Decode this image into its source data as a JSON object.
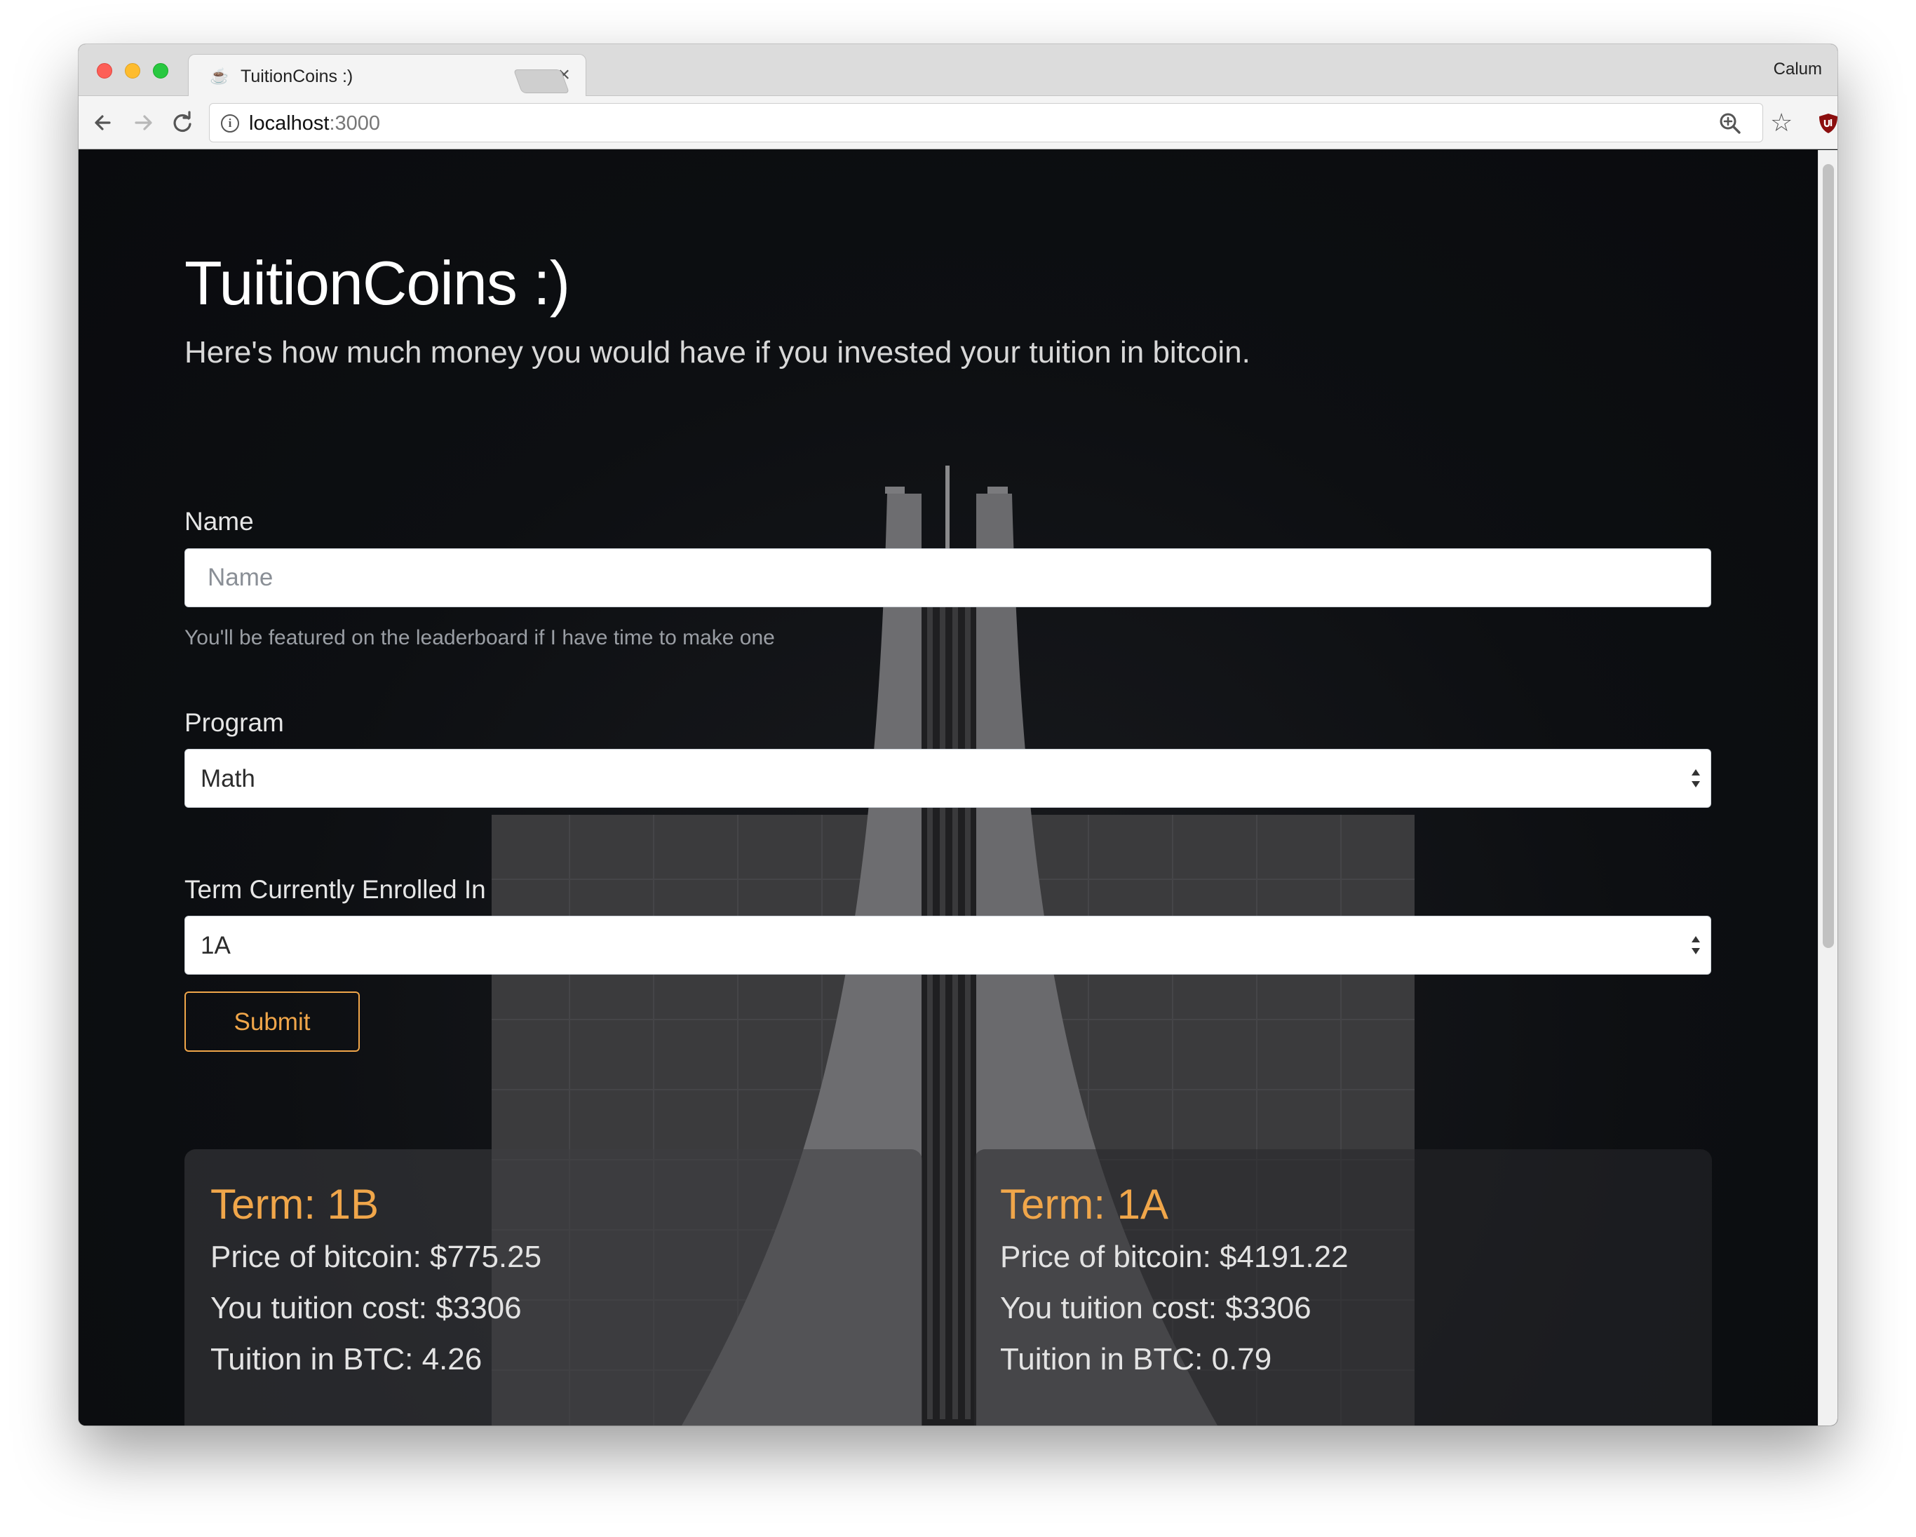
{
  "browser": {
    "tab_title": "TuitionCoins :)",
    "tab_close": "×",
    "profile_name": "Calum",
    "url_host": "localhost",
    "url_port": ":3000"
  },
  "page": {
    "title": "TuitionCoins :)",
    "subtitle": "Here's how much money you would have if you invested your tuition in bitcoin."
  },
  "form": {
    "name_label": "Name",
    "name_placeholder": "Name",
    "name_value": "",
    "name_help": "You'll be featured on the leaderboard if I have time to make one",
    "program_label": "Program",
    "program_value": "Math",
    "term_label": "Term Currently Enrolled In",
    "term_value": "1A",
    "submit_label": "Submit"
  },
  "results": [
    {
      "term": "Term: 1B",
      "price": "Price of bitcoin: $775.25",
      "tuition": "You tuition cost: $3306",
      "btc": "Tuition in BTC: 4.26"
    },
    {
      "term": "Term: 1A",
      "price": "Price of bitcoin: $4191.22",
      "tuition": "You tuition cost: $3306",
      "btc": "Tuition in BTC: 0.79"
    }
  ],
  "colors": {
    "accent": "#f0a64a",
    "page_bg": "#0d0f12",
    "heading": "#ffffff"
  }
}
